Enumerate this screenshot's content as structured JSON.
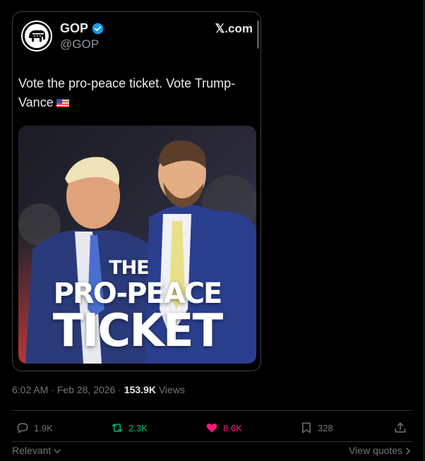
{
  "embed": {
    "display_name": "GOP",
    "handle": "@GOP",
    "source": "𝕏.com",
    "text": "Vote the pro-peace ticket. Vote Trump-Vance",
    "media": {
      "line1": "THE",
      "line2": "PRO-PEACE",
      "line3": "TICKET"
    }
  },
  "meta": {
    "time": "6:02 AM",
    "separator1": "·",
    "date": "Feb 28, 2026",
    "separator2": "·",
    "views_count": "153.9K",
    "views_label": "Views"
  },
  "actions": {
    "replies": "1.9K",
    "reposts": "2.3K",
    "likes": "8.6K",
    "bookmarks": "328"
  },
  "footer": {
    "sort_label": "Relevant",
    "view_quotes": "View quotes"
  },
  "colors": {
    "verified": "#1d9bf0",
    "repost": "#00ba7c",
    "like": "#f91880",
    "muted": "#71767b"
  }
}
